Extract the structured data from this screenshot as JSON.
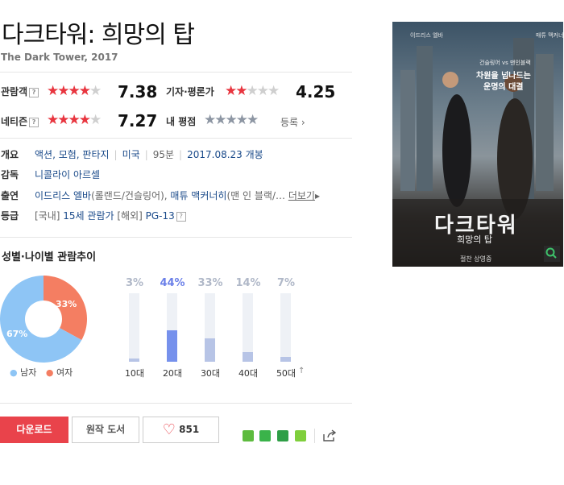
{
  "movie": {
    "title": "다크타워: 희망의 탑",
    "subtitle": "The Dark Tower, 2017"
  },
  "ratings": {
    "audience": {
      "label": "관람객",
      "value": "7.38",
      "score": 7.38
    },
    "critic": {
      "label": "기자·평론가",
      "value": "4.25",
      "score": 4.25
    },
    "netizen": {
      "label": "네티즌",
      "value": "7.27",
      "score": 7.27
    },
    "mine": {
      "label": "내 평점",
      "register": "등록"
    }
  },
  "info": {
    "overview_label": "개요",
    "genre": "액션, 모험, 판타지",
    "country": "미국",
    "runtime": "95분",
    "release": "2017.08.23 개봉",
    "director_label": "감독",
    "director": "니콜라이 아르셀",
    "cast_label": "출연",
    "cast_1": "이드리스 엘바",
    "cast_1_role": "(롤랜드/건슬링어),",
    "cast_2": "매튜 맥커너히",
    "cast_2_role": "(맨 인 블랙/…",
    "cast_more": "더보기",
    "rating_label": "등급",
    "rating_domestic_prefix": "[국내]",
    "rating_domestic": "15세 관람가",
    "rating_foreign_prefix": "[해외]",
    "rating_foreign": "PG-13"
  },
  "poster": {
    "top_left": "이드리스 엘바",
    "top_right": "매튜 맥커너히",
    "tagline_1": "건슬링어 vs 맨인블랙",
    "tagline_2": "차원을 넘나드는",
    "tagline_3": "운명의 대결",
    "title": "다크타워",
    "subtitle": "희망의 탑",
    "release": "절찬 상영중"
  },
  "demographics": {
    "title": "성별·나이별 관람추이",
    "gender": [
      {
        "label": "남자",
        "percent": 67,
        "display": "67%",
        "color": "#8ec5f5"
      },
      {
        "label": "여자",
        "percent": 33,
        "display": "33%",
        "color": "#f47e62"
      }
    ],
    "age": [
      {
        "label": "10대",
        "percent": 3,
        "display": "3%"
      },
      {
        "label": "20대",
        "percent": 44,
        "display": "44%"
      },
      {
        "label": "30대",
        "percent": 33,
        "display": "33%"
      },
      {
        "label": "40대",
        "percent": 14,
        "display": "14%"
      },
      {
        "label": "50대",
        "percent": 7,
        "display": "7%"
      }
    ]
  },
  "actions": {
    "download": "다운로드",
    "original_book": "원작 도서",
    "like_count": "851"
  },
  "colors": {
    "accent_red": "#e9434b",
    "star_red": "#e8353f",
    "bar_highlight": "#7691ec"
  }
}
